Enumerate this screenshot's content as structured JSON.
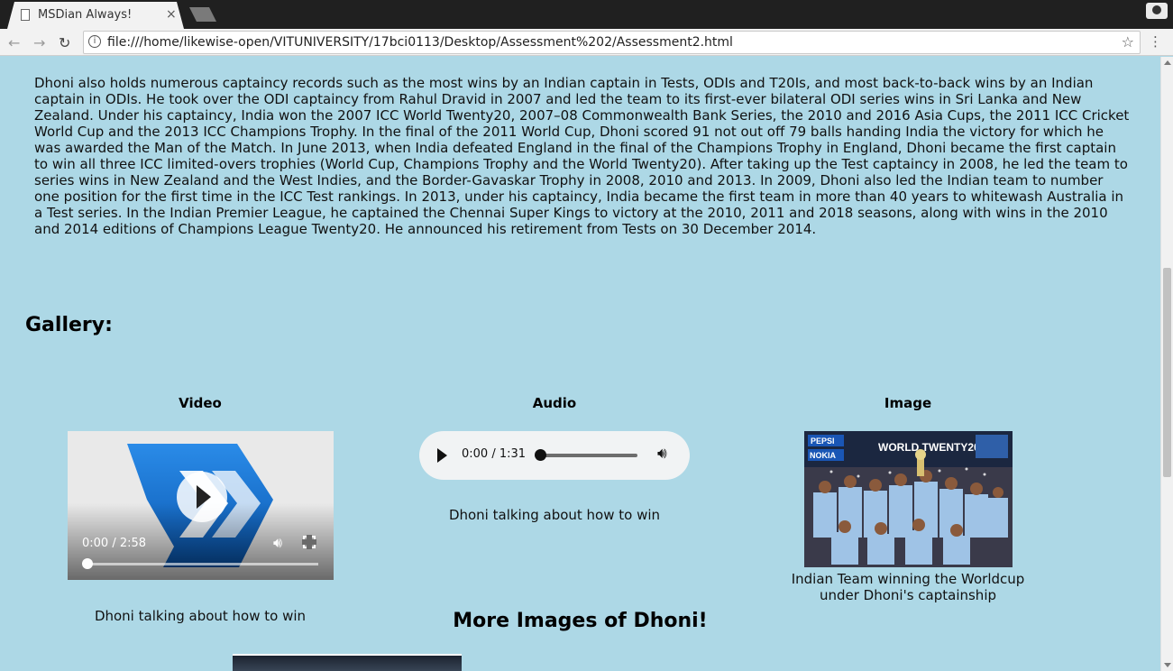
{
  "browser": {
    "tab_title": "MSDian Always!",
    "tab_close": "×",
    "url": "file:///home/likewise-open/VITUNIVERSITY/17bci0113/Desktop/Assessment%202/Assessment2.html",
    "info_glyph": "i",
    "star_glyph": "☆",
    "menu_glyph": "⋮",
    "back_glyph": "←",
    "forward_glyph": "→",
    "reload_glyph": "↻"
  },
  "page": {
    "paragraph": "Dhoni also holds numerous captaincy records such as the most wins by an Indian captain in Tests, ODIs and T20Is, and most back-to-back wins by an Indian captain in ODIs. He took over the ODI captaincy from Rahul Dravid in 2007 and led the team to its first-ever bilateral ODI series wins in Sri Lanka and New Zealand. Under his captaincy, India won the 2007 ICC World Twenty20, 2007–08 Commonwealth Bank Series, the 2010 and 2016 Asia Cups, the 2011 ICC Cricket World Cup and the 2013 ICC Champions Trophy. In the final of the 2011 World Cup, Dhoni scored 91 not out off 79 balls handing India the victory for which he was awarded the Man of the Match. In June 2013, when India defeated England in the final of the Champions Trophy in England, Dhoni became the first captain to win all three ICC limited-overs trophies (World Cup, Champions Trophy and the World Twenty20). After taking up the Test captaincy in 2008, he led the team to series wins in New Zealand and the West Indies, and the Border-Gavaskar Trophy in 2008, 2010 and 2013. In 2009, Dhoni also led the Indian team to number one position for the first time in the ICC Test rankings. In 2013, under his captaincy, India became the first team in more than 40 years to whitewash Australia in a Test series. In the Indian Premier League, he captained the Chennai Super Kings to victory at the 2010, 2011 and 2018 seasons, along with wins in the 2010 and 2014 editions of Champions League Twenty20. He announced his retirement from Tests on 30 December 2014.",
    "gallery_heading": "Gallery:",
    "video": {
      "label": "Video",
      "time": "0:00 / 2:58",
      "caption": "Dhoni talking about how to win",
      "progress": 0
    },
    "audio": {
      "label": "Audio",
      "time": "0:00 / 1:31",
      "caption": "Dhoni talking about how to win",
      "progress": 0
    },
    "image": {
      "label": "Image",
      "caption": "Indian Team winning the Worldcup under Dhoni's captainship",
      "banner_text": "WORLD TWENTY20",
      "sponsor_1": "PEPSI",
      "sponsor_2": "NOKIA"
    },
    "more_heading": "More Images of Dhoni!"
  },
  "colors": {
    "page_bg": "#add8e6",
    "logo_blue": "#0c6fd0"
  }
}
